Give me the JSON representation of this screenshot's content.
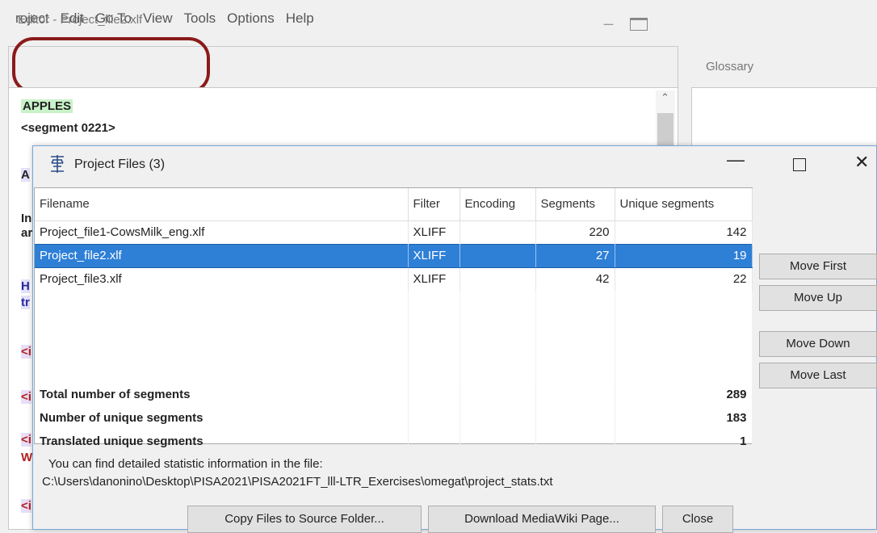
{
  "menu": {
    "items": [
      "roject",
      "Edit",
      "Go To",
      "View",
      "Tools",
      "Options",
      "Help"
    ]
  },
  "editor": {
    "title": "Editor - Project_file2.xlf",
    "apples": "APPLES",
    "segment": "<segment 0221>",
    "frags": [
      "A",
      "In",
      "ar",
      "H",
      "tr",
      "<i",
      "<i",
      "<i",
      "W",
      "<i"
    ]
  },
  "glossary": {
    "title": "Glossary"
  },
  "dialog": {
    "title": "Project Files (3)",
    "columns": [
      "Filename",
      "Filter",
      "Encoding",
      "Segments",
      "Unique segments"
    ],
    "rows": [
      {
        "filename": "Project_file1-CowsMilk_eng.xlf",
        "filter": "XLIFF",
        "encoding": "",
        "segments": "220",
        "unique": "142"
      },
      {
        "filename": "Project_file2.xlf",
        "filter": "XLIFF",
        "encoding": "",
        "segments": "27",
        "unique": "19"
      },
      {
        "filename": "Project_file3.xlf",
        "filter": "XLIFF",
        "encoding": "",
        "segments": "42",
        "unique": "22"
      }
    ],
    "totals": [
      {
        "label": "Total number of segments",
        "value": "289"
      },
      {
        "label": "Number of unique segments",
        "value": "183"
      },
      {
        "label": "Translated unique segments",
        "value": "1"
      }
    ],
    "side_buttons": {
      "move_first": "Move First",
      "move_up": "Move Up",
      "move_down": "Move Down",
      "move_last": "Move Last"
    },
    "info_line1": "You can find detailed statistic information in the file:",
    "info_line2": "C:\\Users\\danonino\\Desktop\\PISA2021\\PISA2021FT_lll-LTR_Exercises\\omegat\\project_stats.txt",
    "bottom_buttons": {
      "copy_files": "Copy Files to Source Folder...",
      "download_mediawiki": "Download MediaWiki Page...",
      "close": "Close"
    }
  },
  "colors": {
    "selection": "#2e7fd6",
    "highlight_oval": "#8b1a1a",
    "apples_bg": "#c9f2c9"
  }
}
